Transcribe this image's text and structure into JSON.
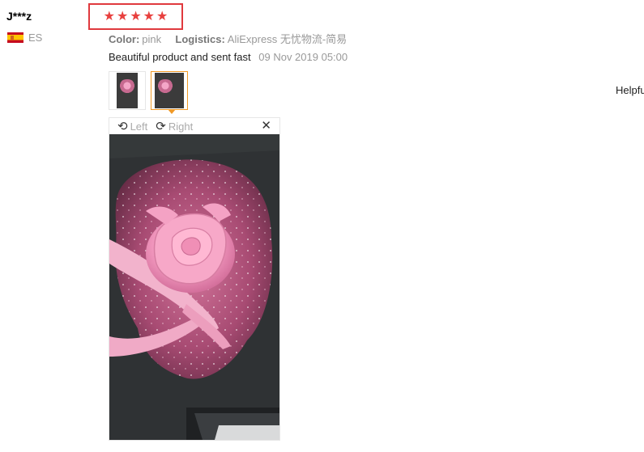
{
  "user": {
    "name": "J***z",
    "country": "ES"
  },
  "rating": {
    "stars": 5,
    "max": 5,
    "star_glyph": "★"
  },
  "meta": {
    "color_label": "Color:",
    "color_value": "pink",
    "logistics_label": "Logistics:",
    "logistics_value": "AliExpress 无忧物流-简易"
  },
  "review": {
    "text": "Beautiful product and sent fast",
    "date": "09 Nov 2019 05:00"
  },
  "helpful": "Helpfu",
  "viewer": {
    "left_label": "Left",
    "right_label": "Right",
    "rotate_left_glyph": "⟲",
    "rotate_right_glyph": "⟳",
    "close_glyph": "✕"
  },
  "colors": {
    "star": "#e8403e",
    "highlight_border": "#e0393e",
    "active_thumb": "#f09a27"
  }
}
